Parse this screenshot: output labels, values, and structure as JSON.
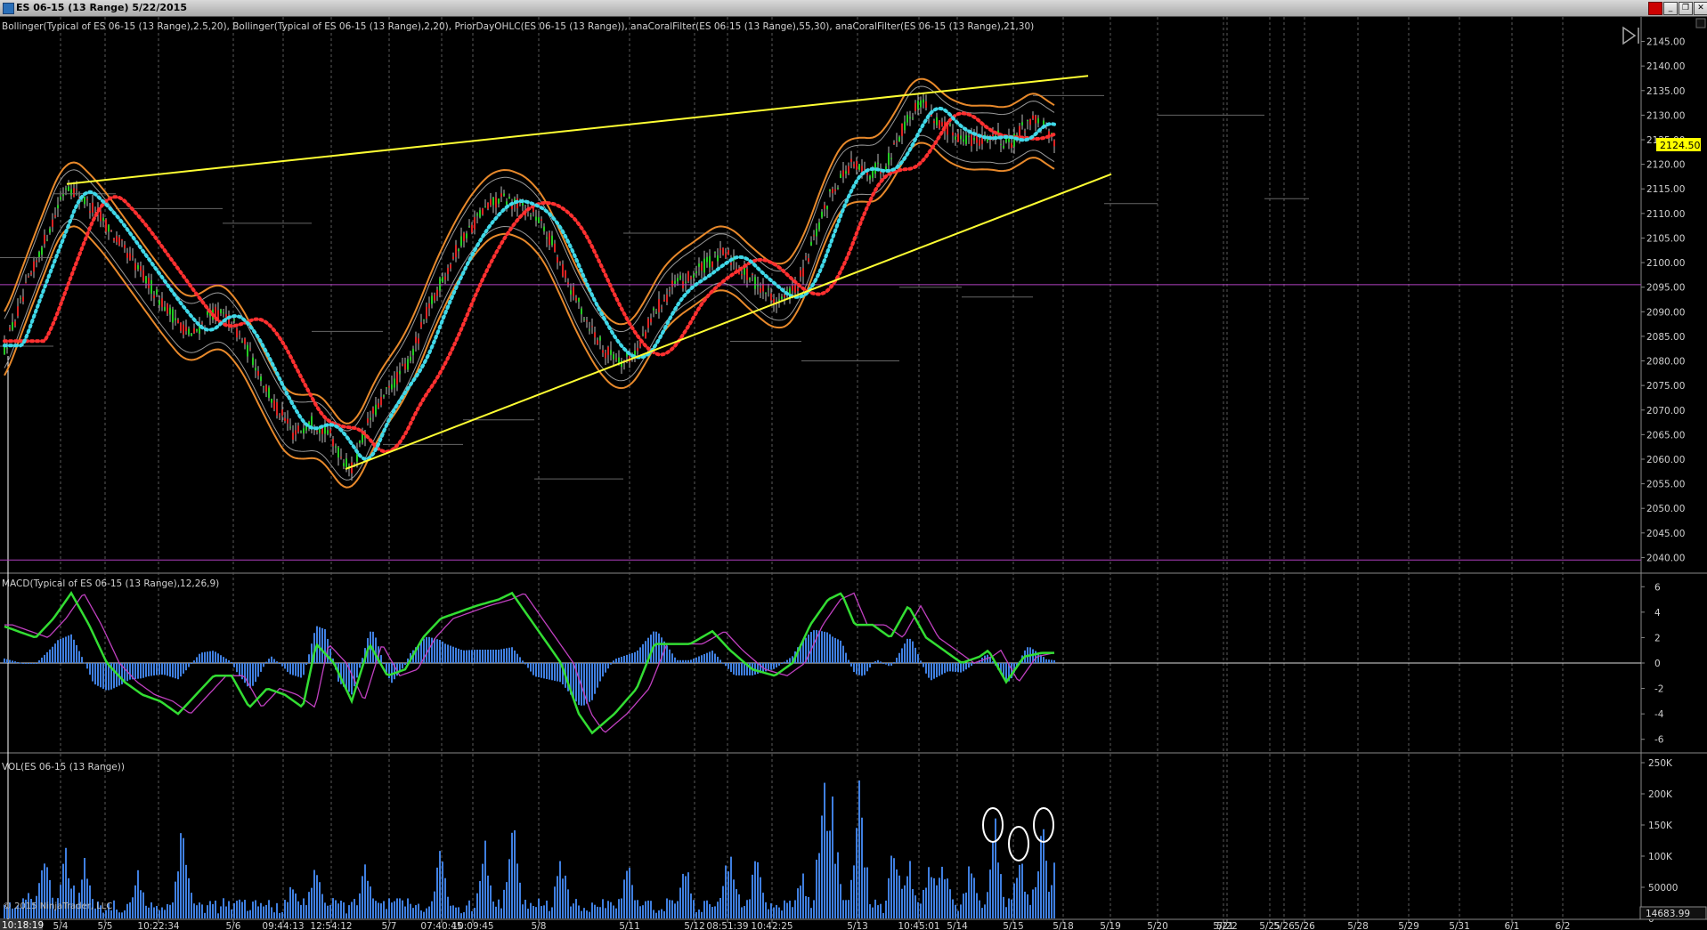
{
  "window": {
    "title": "ES 06-15 (13 Range)  5/22/2015",
    "buttons": [
      "close-red",
      "minimize",
      "maximize",
      "close"
    ]
  },
  "panels": {
    "price": {
      "header": "Bollinger(Typical of ES 06-15 (13 Range),2.5,20), Bollinger(Typical of ES 06-15 (13 Range),2,20), PriorDayOHLC(ES 06-15 (13 Range)), anaCoralFilter(ES 06-15 (13 Range),55,30), anaCoralFilter(ES 06-15 (13 Range),21,30)",
      "last_price": "2124.50"
    },
    "macd": {
      "header": "MACD(Typical of ES 06-15 (13 Range),12,26,9)"
    },
    "volume": {
      "header": "VOL(ES 06-15 (13 Range))",
      "last_value": "14683.99"
    }
  },
  "footer": {
    "copyright": "© 2015 NinjaTrader, LLC",
    "current_time": "10:18:19"
  },
  "chart_data": [
    {
      "type": "candlestick",
      "title": "ES 06-15 (13 Range)",
      "y_ticks": [
        "2145.00",
        "2140.00",
        "2135.00",
        "2130.00",
        "2125.00",
        "2120.00",
        "2115.00",
        "2110.00",
        "2105.00",
        "2100.00",
        "2095.00",
        "2090.00",
        "2085.00",
        "2080.00",
        "2075.00",
        "2070.00",
        "2065.00",
        "2060.00",
        "2055.00",
        "2050.00",
        "2045.00",
        "2040.00"
      ],
      "ylim": [
        2037,
        2148
      ],
      "x_ticks": [
        "5/4",
        "5/5",
        "10:22:34",
        "5/6",
        "09:44:13",
        "12:54:12",
        "5/7",
        "07:40:45",
        "10:09:45",
        "5/8",
        "5/11",
        "5/12",
        "08:51:39",
        "10:42:25",
        "5/13",
        "10:45:01",
        "5/14",
        "5/15",
        "5/18",
        "5/19",
        "5/20",
        "5/21",
        "5/22",
        "5/25",
        "5/26",
        "5/26",
        "5/28",
        "5/29",
        "5/31",
        "6/1",
        "6/2"
      ],
      "price_path": [
        [
          0,
          2080
        ],
        [
          30,
          2095
        ],
        [
          75,
          2116
        ],
        [
          110,
          2110
        ],
        [
          150,
          2100
        ],
        [
          190,
          2090
        ],
        [
          215,
          2085
        ],
        [
          240,
          2090
        ],
        [
          260,
          2088
        ],
        [
          285,
          2080
        ],
        [
          305,
          2072
        ],
        [
          330,
          2065
        ],
        [
          350,
          2068
        ],
        [
          370,
          2065
        ],
        [
          385,
          2060
        ],
        [
          395,
          2058
        ],
        [
          415,
          2068
        ],
        [
          440,
          2075
        ],
        [
          460,
          2080
        ],
        [
          480,
          2090
        ],
        [
          500,
          2098
        ],
        [
          520,
          2105
        ],
        [
          540,
          2110
        ],
        [
          560,
          2113
        ],
        [
          580,
          2112
        ],
        [
          600,
          2110
        ],
        [
          620,
          2104
        ],
        [
          640,
          2095
        ],
        [
          660,
          2088
        ],
        [
          680,
          2082
        ],
        [
          700,
          2080
        ],
        [
          715,
          2082
        ],
        [
          735,
          2090
        ],
        [
          755,
          2095
        ],
        [
          775,
          2097
        ],
        [
          795,
          2100
        ],
        [
          815,
          2102
        ],
        [
          835,
          2098
        ],
        [
          855,
          2095
        ],
        [
          875,
          2092
        ],
        [
          895,
          2095
        ],
        [
          915,
          2105
        ],
        [
          935,
          2115
        ],
        [
          955,
          2120
        ],
        [
          975,
          2118
        ],
        [
          995,
          2120
        ],
        [
          1015,
          2128
        ],
        [
          1035,
          2133
        ],
        [
          1055,
          2128
        ],
        [
          1075,
          2126
        ],
        [
          1095,
          2125
        ],
        [
          1115,
          2126
        ],
        [
          1135,
          2124
        ],
        [
          1155,
          2129
        ],
        [
          1170,
          2128
        ],
        [
          1184,
          2124.5
        ]
      ],
      "upper_trendline": [
        [
          75,
          2116
        ],
        [
          1222,
          2138
        ]
      ],
      "lower_trendline": [
        [
          388,
          2058
        ],
        [
          1248,
          2118
        ]
      ],
      "prior_day_line": 2095.5,
      "lower_reference_line": 2039.5,
      "last_price": 2124.5
    },
    {
      "type": "line",
      "title": "MACD(Typical of ES 06-15 (13 Range),12,26,9)",
      "y_ticks": [
        "6",
        "4",
        "2",
        "0",
        "-2",
        "-4",
        "-6"
      ],
      "ylim": [
        -7,
        7
      ],
      "macd_path": [
        [
          0,
          3
        ],
        [
          20,
          2.5
        ],
        [
          40,
          2
        ],
        [
          60,
          3.5
        ],
        [
          80,
          5.5
        ],
        [
          100,
          3
        ],
        [
          120,
          0
        ],
        [
          140,
          -1.5
        ],
        [
          160,
          -2.5
        ],
        [
          180,
          -3
        ],
        [
          200,
          -4
        ],
        [
          220,
          -2.5
        ],
        [
          240,
          -1
        ],
        [
          260,
          -1
        ],
        [
          280,
          -3.5
        ],
        [
          300,
          -2
        ],
        [
          320,
          -2.5
        ],
        [
          340,
          -3.5
        ],
        [
          355,
          1.5
        ],
        [
          375,
          0
        ],
        [
          395,
          -3
        ],
        [
          415,
          1.5
        ],
        [
          435,
          -1
        ],
        [
          455,
          -0.5
        ],
        [
          475,
          2
        ],
        [
          495,
          3.5
        ],
        [
          515,
          4
        ],
        [
          535,
          4.5
        ],
        [
          560,
          5
        ],
        [
          575,
          5.5
        ],
        [
          590,
          4
        ],
        [
          610,
          2
        ],
        [
          630,
          0
        ],
        [
          650,
          -4
        ],
        [
          665,
          -5.5
        ],
        [
          690,
          -4
        ],
        [
          715,
          -2
        ],
        [
          735,
          1.5
        ],
        [
          755,
          1.5
        ],
        [
          775,
          1.5
        ],
        [
          800,
          2.5
        ],
        [
          820,
          1
        ],
        [
          845,
          -0.5
        ],
        [
          870,
          -1
        ],
        [
          890,
          0
        ],
        [
          910,
          3
        ],
        [
          930,
          5
        ],
        [
          945,
          5.5
        ],
        [
          960,
          3
        ],
        [
          980,
          3
        ],
        [
          1000,
          2
        ],
        [
          1020,
          4.5
        ],
        [
          1040,
          2
        ],
        [
          1060,
          1
        ],
        [
          1080,
          0
        ],
        [
          1100,
          0.5
        ],
        [
          1110,
          1
        ],
        [
          1130,
          -1.5
        ],
        [
          1150,
          0.5
        ],
        [
          1170,
          0.8
        ],
        [
          1184,
          0.8
        ]
      ]
    },
    {
      "type": "bar",
      "title": "VOL(ES 06-15 (13 Range))",
      "y_ticks": [
        "250K",
        "200K",
        "150K",
        "100K",
        "50000",
        "0"
      ],
      "ylim": [
        0,
        250000
      ],
      "volume_peaks": [
        [
          30,
          55000
        ],
        [
          50,
          130000
        ],
        [
          75,
          125000
        ],
        [
          95,
          115000
        ],
        [
          155,
          90000
        ],
        [
          205,
          170000
        ],
        [
          330,
          75000
        ],
        [
          355,
          115000
        ],
        [
          410,
          100000
        ],
        [
          495,
          120000
        ],
        [
          545,
          130000
        ],
        [
          575,
          185000
        ],
        [
          630,
          110000
        ],
        [
          705,
          115000
        ],
        [
          770,
          105000
        ],
        [
          820,
          155000
        ],
        [
          850,
          110000
        ],
        [
          900,
          90000
        ],
        [
          925,
          235000
        ],
        [
          935,
          200000
        ],
        [
          965,
          240000
        ],
        [
          1005,
          150000
        ],
        [
          1020,
          125000
        ],
        [
          1045,
          125000
        ],
        [
          1060,
          115000
        ],
        [
          1090,
          105000
        ],
        [
          1118,
          170000
        ],
        [
          1145,
          115000
        ],
        [
          1170,
          175000
        ],
        [
          1184,
          110000
        ]
      ],
      "circled_spikes": [
        [
          1115,
          150000
        ],
        [
          1144,
          120000
        ],
        [
          1172,
          150000
        ]
      ]
    }
  ]
}
